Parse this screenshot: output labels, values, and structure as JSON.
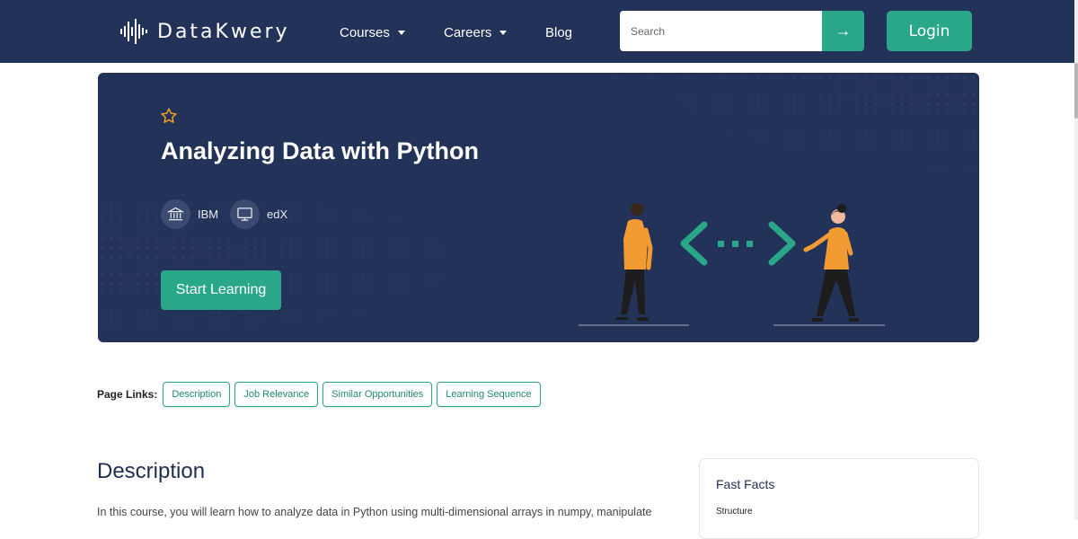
{
  "brand": {
    "name": "DataKwery"
  },
  "nav": {
    "courses": "Courses",
    "careers": "Careers",
    "blog": "Blog",
    "search_placeholder": "Search",
    "search_button": "→",
    "login": "Login"
  },
  "hero": {
    "title": "Analyzing Data with Python",
    "providers": [
      {
        "name": "IBM",
        "icon": "institution-icon"
      },
      {
        "name": "edX",
        "icon": "monitor-icon"
      }
    ],
    "cta": "Start Learning"
  },
  "page_links": {
    "label": "Page Links:",
    "items": [
      "Description",
      "Job Relevance",
      "Similar Opportunities",
      "Learning Sequence"
    ]
  },
  "description": {
    "heading": "Description",
    "text": "In this course, you will learn how to analyze data in Python using multi-dimensional arrays in numpy, manipulate"
  },
  "fast_facts": {
    "title": "Fast Facts",
    "first_label": "Structure"
  },
  "colors": {
    "navy": "#233258",
    "accent": "#2aa689",
    "star": "#f0a020"
  }
}
